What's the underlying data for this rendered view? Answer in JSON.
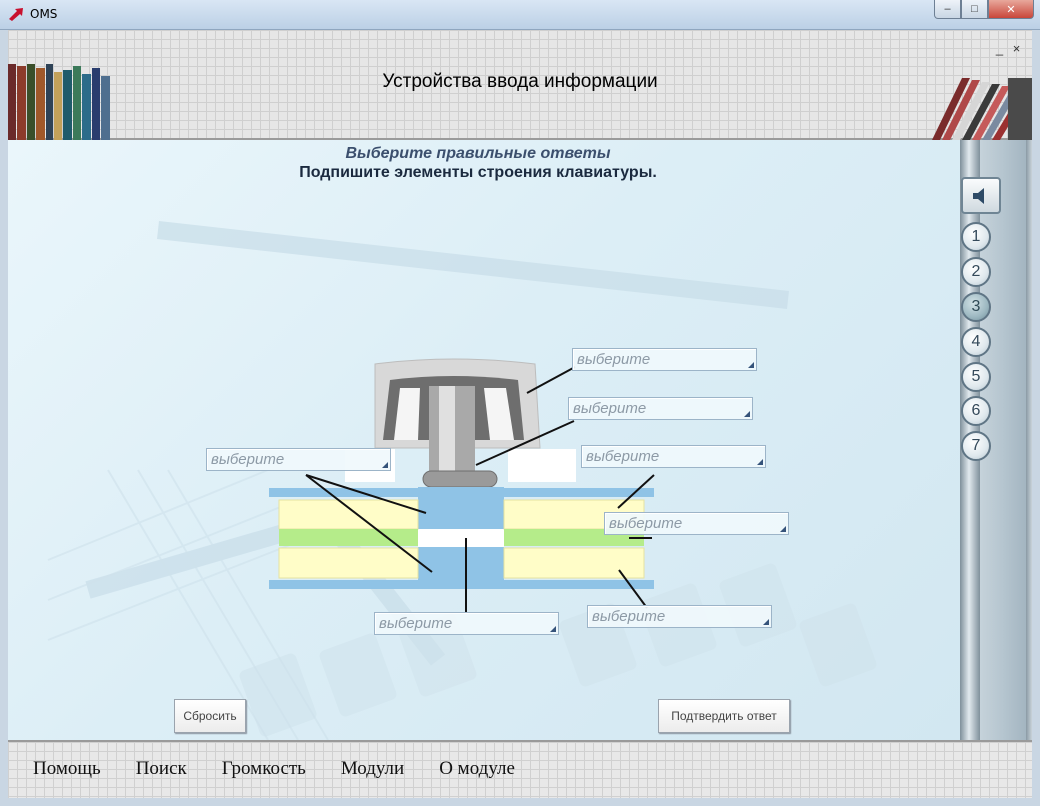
{
  "window": {
    "title": "OMS",
    "minimize": "‒",
    "maximize": "□",
    "close": "✕"
  },
  "header": {
    "title": "Устройства ввода информации",
    "mini_minimize": "_",
    "mini_close": "×"
  },
  "task": {
    "instruction": "Выберите правильные ответы",
    "prompt": "Подпишите элементы строения клавиатуры."
  },
  "dropdowns": [
    {
      "placeholder": "выберите"
    },
    {
      "placeholder": "выберите"
    },
    {
      "placeholder": "выберите"
    },
    {
      "placeholder": "выберите"
    },
    {
      "placeholder": "выберите"
    },
    {
      "placeholder": "выберите"
    },
    {
      "placeholder": "выберите"
    }
  ],
  "buttons": {
    "reset": "Сбросить",
    "submit": "Подтвердить ответ"
  },
  "nav": {
    "speaker_icon": "speaker-icon",
    "pages": [
      "1",
      "2",
      "3",
      "4",
      "5",
      "6",
      "7"
    ],
    "active_page": "3"
  },
  "menu": {
    "items": [
      "Помощь",
      "Поиск",
      "Громкость",
      "Модули",
      "О модуле"
    ]
  }
}
